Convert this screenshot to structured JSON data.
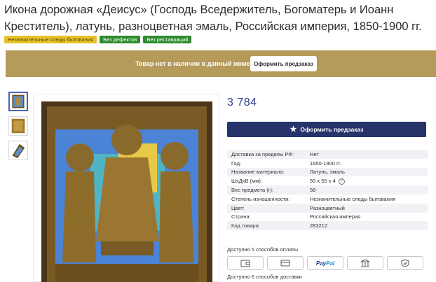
{
  "title": "Икона дорожная «Деисус» (Господь Вседержитель, Богоматерь и Иоанн Креститель), латунь, разноцветная эмаль, Российская империя, 1850-1900 гг.",
  "tags": [
    {
      "label": "Незначительные следы бытования",
      "color": "#e6c229"
    },
    {
      "label": "Без дефектов",
      "color": "#2e8b2e"
    },
    {
      "label": "Без реставраций",
      "color": "#2e8b2e"
    }
  ],
  "banner": {
    "text": "Товар нет в наличии в данный момент.",
    "button": "Оформить предзаказ",
    "color": "#b59a5a"
  },
  "price": "3 784 ",
  "buy_button": {
    "label": "Оформить предзаказ",
    "icon": "star-icon",
    "color": "#27336b"
  },
  "specs": [
    {
      "key": "Доставка за пределы РФ:",
      "value": "Нет"
    },
    {
      "key": "Год:",
      "value": "1850-1900 гг."
    },
    {
      "key": "Название материала:",
      "value": "Латунь, эмаль"
    },
    {
      "key": "ШхДхВ (мм):",
      "value": "50 х 55 х 4"
    },
    {
      "key": "Вес предмета (г):",
      "value": "58"
    },
    {
      "key": "Степень изношенности:",
      "value": "Незначительные следы бытования"
    },
    {
      "key": "Цвет:",
      "value": "Разноцветный"
    },
    {
      "key": "Страна:",
      "value": "Российская империя"
    },
    {
      "key": "Код товара:",
      "value": "283212"
    }
  ],
  "help_icon_text": "?",
  "payment": {
    "label": "Доступно 5 способов оплаты",
    "methods": [
      {
        "name": "wallet-icon"
      },
      {
        "name": "card-icon"
      },
      {
        "name": "paypal",
        "text_a": "Pay",
        "text_b": "Pal"
      },
      {
        "name": "bank-icon"
      },
      {
        "name": "shield-icon"
      }
    ]
  },
  "delivery_label": "Доступно 6 способов доставки"
}
